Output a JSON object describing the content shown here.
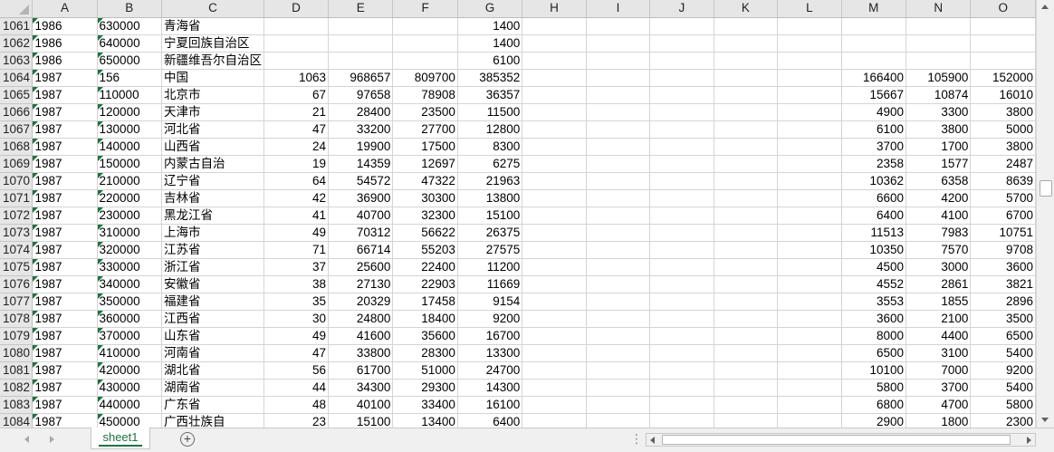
{
  "columns": [
    "A",
    "B",
    "C",
    "D",
    "E",
    "F",
    "G",
    "H",
    "I",
    "J",
    "K",
    "L",
    "M",
    "N",
    "O"
  ],
  "rows": [
    {
      "n": "1061",
      "A": "1986",
      "B": "630000",
      "C": "青海省",
      "D": "",
      "E": "",
      "F": "",
      "G": "1400",
      "M": "",
      "N": "",
      "O": ""
    },
    {
      "n": "1062",
      "A": "1986",
      "B": "640000",
      "C": "宁夏回族自治区",
      "D": "",
      "E": "",
      "F": "",
      "G": "1400",
      "M": "",
      "N": "",
      "O": ""
    },
    {
      "n": "1063",
      "A": "1986",
      "B": "650000",
      "C": "新疆维吾尔自治区",
      "D": "",
      "E": "",
      "F": "",
      "G": "6100",
      "M": "",
      "N": "",
      "O": ""
    },
    {
      "n": "1064",
      "A": "1987",
      "B": "156",
      "C": "中国",
      "D": "1063",
      "E": "968657",
      "F": "809700",
      "G": "385352",
      "M": "166400",
      "N": "105900",
      "O": "152000"
    },
    {
      "n": "1065",
      "A": "1987",
      "B": "110000",
      "C": "北京市",
      "D": "67",
      "E": "97658",
      "F": "78908",
      "G": "36357",
      "M": "15667",
      "N": "10874",
      "O": "16010"
    },
    {
      "n": "1066",
      "A": "1987",
      "B": "120000",
      "C": "天津市",
      "D": "21",
      "E": "28400",
      "F": "23500",
      "G": "11500",
      "M": "4900",
      "N": "3300",
      "O": "3800"
    },
    {
      "n": "1067",
      "A": "1987",
      "B": "130000",
      "C": "河北省",
      "D": "47",
      "E": "33200",
      "F": "27700",
      "G": "12800",
      "M": "6100",
      "N": "3800",
      "O": "5000"
    },
    {
      "n": "1068",
      "A": "1987",
      "B": "140000",
      "C": "山西省",
      "D": "24",
      "E": "19900",
      "F": "17500",
      "G": "8300",
      "M": "3700",
      "N": "1700",
      "O": "3800"
    },
    {
      "n": "1069",
      "A": "1987",
      "B": "150000",
      "C": "内蒙古自治",
      "D": "19",
      "E": "14359",
      "F": "12697",
      "G": "6275",
      "M": "2358",
      "N": "1577",
      "O": "2487"
    },
    {
      "n": "1070",
      "A": "1987",
      "B": "210000",
      "C": "辽宁省",
      "D": "64",
      "E": "54572",
      "F": "47322",
      "G": "21963",
      "M": "10362",
      "N": "6358",
      "O": "8639"
    },
    {
      "n": "1071",
      "A": "1987",
      "B": "220000",
      "C": "吉林省",
      "D": "42",
      "E": "36900",
      "F": "30300",
      "G": "13800",
      "M": "6600",
      "N": "4200",
      "O": "5700"
    },
    {
      "n": "1072",
      "A": "1987",
      "B": "230000",
      "C": "黑龙江省",
      "D": "41",
      "E": "40700",
      "F": "32300",
      "G": "15100",
      "M": "6400",
      "N": "4100",
      "O": "6700"
    },
    {
      "n": "1073",
      "A": "1987",
      "B": "310000",
      "C": "上海市",
      "D": "49",
      "E": "70312",
      "F": "56622",
      "G": "26375",
      "M": "11513",
      "N": "7983",
      "O": "10751"
    },
    {
      "n": "1074",
      "A": "1987",
      "B": "320000",
      "C": "江苏省",
      "D": "71",
      "E": "66714",
      "F": "55203",
      "G": "27575",
      "M": "10350",
      "N": "7570",
      "O": "9708"
    },
    {
      "n": "1075",
      "A": "1987",
      "B": "330000",
      "C": "浙江省",
      "D": "37",
      "E": "25600",
      "F": "22400",
      "G": "11200",
      "M": "4500",
      "N": "3000",
      "O": "3600"
    },
    {
      "n": "1076",
      "A": "1987",
      "B": "340000",
      "C": "安徽省",
      "D": "38",
      "E": "27130",
      "F": "22903",
      "G": "11669",
      "M": "4552",
      "N": "2861",
      "O": "3821"
    },
    {
      "n": "1077",
      "A": "1987",
      "B": "350000",
      "C": "福建省",
      "D": "35",
      "E": "20329",
      "F": "17458",
      "G": "9154",
      "M": "3553",
      "N": "1855",
      "O": "2896"
    },
    {
      "n": "1078",
      "A": "1987",
      "B": "360000",
      "C": "江西省",
      "D": "30",
      "E": "24800",
      "F": "18400",
      "G": "9200",
      "M": "3600",
      "N": "2100",
      "O": "3500"
    },
    {
      "n": "1079",
      "A": "1987",
      "B": "370000",
      "C": "山东省",
      "D": "49",
      "E": "41600",
      "F": "35600",
      "G": "16700",
      "M": "8000",
      "N": "4400",
      "O": "6500"
    },
    {
      "n": "1080",
      "A": "1987",
      "B": "410000",
      "C": "河南省",
      "D": "47",
      "E": "33800",
      "F": "28300",
      "G": "13300",
      "M": "6500",
      "N": "3100",
      "O": "5400"
    },
    {
      "n": "1081",
      "A": "1987",
      "B": "420000",
      "C": "湖北省",
      "D": "56",
      "E": "61700",
      "F": "51000",
      "G": "24700",
      "M": "10100",
      "N": "7000",
      "O": "9200"
    },
    {
      "n": "1082",
      "A": "1987",
      "B": "430000",
      "C": "湖南省",
      "D": "44",
      "E": "34300",
      "F": "29300",
      "G": "14300",
      "M": "5800",
      "N": "3700",
      "O": "5400"
    },
    {
      "n": "1083",
      "A": "1987",
      "B": "440000",
      "C": "广东省",
      "D": "48",
      "E": "40100",
      "F": "33400",
      "G": "16100",
      "M": "6800",
      "N": "4700",
      "O": "5800"
    },
    {
      "n": "1084",
      "A": "1987",
      "B": "450000",
      "C": "广西壮族自",
      "D": "23",
      "E": "15100",
      "F": "13400",
      "G": "6400",
      "M": "2900",
      "N": "1800",
      "O": "2300"
    }
  ],
  "sheet_tabs": [
    {
      "label": "sheet1",
      "active": true
    }
  ],
  "add_sheet_label": "+",
  "colors": {
    "accent": "#1e7145",
    "header_bg": "#e6e6e6",
    "grid_line": "#d4d4d4"
  }
}
